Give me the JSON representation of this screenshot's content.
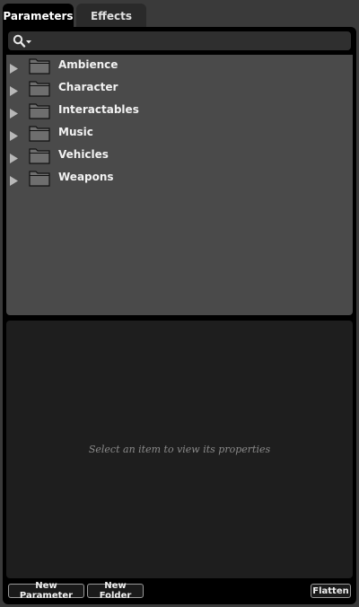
{
  "tabs": [
    {
      "label": "Parameters",
      "active": true
    },
    {
      "label": "Effects",
      "active": false
    }
  ],
  "search": {
    "placeholder": "",
    "value": ""
  },
  "tree": {
    "items": [
      {
        "label": "Ambience",
        "icon": "folder-icon",
        "expanded": false
      },
      {
        "label": "Character",
        "icon": "folder-icon",
        "expanded": false
      },
      {
        "label": "Interactables",
        "icon": "folder-icon",
        "expanded": false
      },
      {
        "label": "Music",
        "icon": "folder-icon",
        "expanded": false
      },
      {
        "label": "Vehicles",
        "icon": "folder-icon",
        "expanded": false
      },
      {
        "label": "Weapons",
        "icon": "folder-icon",
        "expanded": false
      }
    ]
  },
  "properties": {
    "hint": "Select an item to view its properties"
  },
  "buttons": {
    "new_parameter": "New Parameter",
    "new_folder": "New Folder",
    "flatten": "Flatten"
  },
  "colors": {
    "background": "#3a3a3a",
    "panel": "#000000",
    "tree_bg": "#4a4a4a",
    "props_bg": "#1e1e1e",
    "folder_fill": "#6e6e6e"
  }
}
